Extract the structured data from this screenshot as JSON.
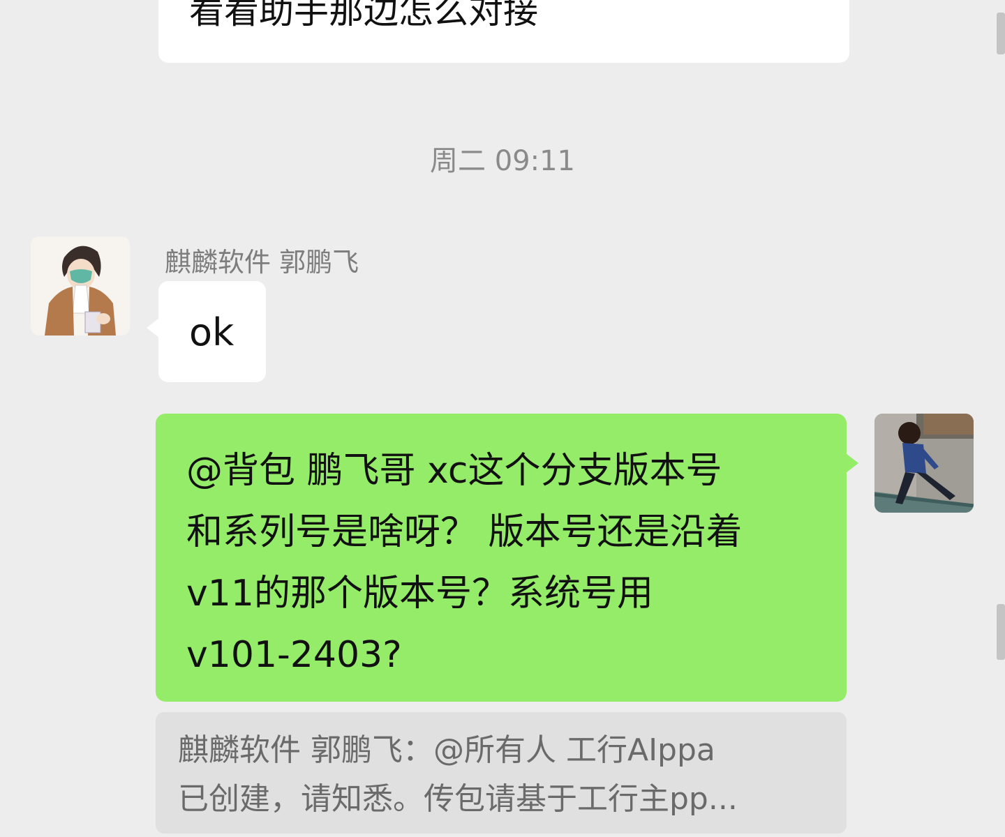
{
  "chat": {
    "prev_message": "看看助手那边怎么对接",
    "timestamp": "周二 09:11",
    "messages": [
      {
        "sender": "麒麟软件 郭鹏飞",
        "text": "ok"
      },
      {
        "text_lines": [
          "@背包  鹏飞哥 xc这个分支版本号",
          "和系列号是啥呀？ 版本号还是沿着",
          "v11的那个版本号？系统号用",
          "v101-2403?"
        ]
      }
    ],
    "quote": {
      "lines": [
        "麒麟软件 郭鹏飞：@所有人 工行AIppa",
        "已创建，请知悉。传包请基于工行主pp..."
      ]
    }
  },
  "colors": {
    "background": "#ededed",
    "received_bubble": "#ffffff",
    "sent_bubble": "#95ec69",
    "quote_bg": "#e0e0e0"
  },
  "icons": {
    "left_avatar": "anime-character-avatar",
    "right_avatar": "running-child-photo-avatar"
  }
}
